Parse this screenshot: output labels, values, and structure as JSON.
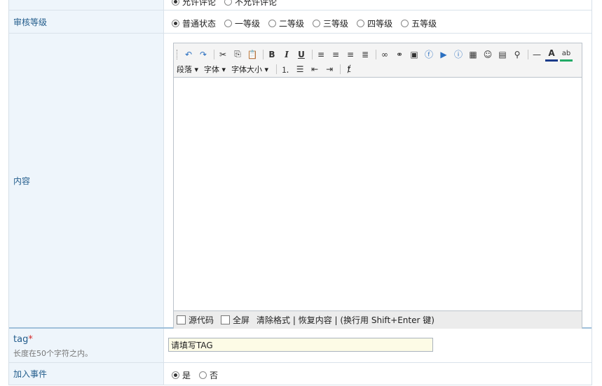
{
  "rows": {
    "comment": {
      "options": [
        {
          "label": "允许评论",
          "checked": true
        },
        {
          "label": "不允许评论",
          "checked": false
        }
      ]
    },
    "review": {
      "label": "审核等级",
      "options": [
        {
          "label": "普通状态",
          "checked": true
        },
        {
          "label": "一等级",
          "checked": false
        },
        {
          "label": "二等级",
          "checked": false
        },
        {
          "label": "三等级",
          "checked": false
        },
        {
          "label": "四等级",
          "checked": false
        },
        {
          "label": "五等级",
          "checked": false
        }
      ]
    },
    "content": {
      "label": "内容"
    },
    "tag": {
      "label": "tag",
      "required_mark": "*",
      "hint": "长度在50个字符之内。",
      "value": "请填写TAG"
    },
    "event": {
      "label": "加入事件",
      "options": [
        {
          "label": "是",
          "checked": true
        },
        {
          "label": "否",
          "checked": false
        }
      ]
    }
  },
  "editor": {
    "toolbar_row1": [
      {
        "name": "undo-icon",
        "glyph": "↶"
      },
      {
        "name": "redo-icon",
        "glyph": "↷"
      },
      {
        "sep": true
      },
      {
        "name": "cut-icon",
        "glyph": "✂"
      },
      {
        "name": "copy-icon",
        "glyph": "⎘"
      },
      {
        "name": "paste-icon",
        "glyph": "📋"
      },
      {
        "sep": true
      },
      {
        "name": "bold-icon",
        "glyph": "B"
      },
      {
        "name": "italic-icon",
        "glyph": "I"
      },
      {
        "name": "underline-icon",
        "glyph": "U"
      },
      {
        "sep": true
      },
      {
        "name": "align-left-icon",
        "glyph": "≡"
      },
      {
        "name": "align-center-icon",
        "glyph": "≡"
      },
      {
        "name": "align-right-icon",
        "glyph": "≡"
      },
      {
        "name": "align-justify-icon",
        "glyph": "≣"
      },
      {
        "sep": true
      },
      {
        "name": "link-icon",
        "glyph": "∞"
      },
      {
        "name": "unlink-icon",
        "glyph": "⚭"
      },
      {
        "name": "image-icon",
        "glyph": "▣"
      },
      {
        "name": "flash-icon",
        "glyph": "ⓕ"
      },
      {
        "name": "media-icon",
        "glyph": "▶"
      },
      {
        "name": "info-icon",
        "glyph": "ⓘ"
      },
      {
        "name": "table-icon",
        "glyph": "▦"
      },
      {
        "name": "emoticon-icon",
        "glyph": "☺"
      },
      {
        "name": "page-icon",
        "glyph": "▤"
      },
      {
        "name": "find-icon",
        "glyph": "⚲"
      },
      {
        "sep": true
      },
      {
        "name": "horizontal-rule-icon",
        "glyph": "—"
      },
      {
        "name": "font-color-icon",
        "glyph": "A"
      },
      {
        "name": "highlight-icon",
        "glyph": "ab"
      }
    ],
    "dropdowns": [
      "段落",
      "字体",
      "字体大小"
    ],
    "toolbar_row2": [
      {
        "name": "ordered-list-icon",
        "glyph": "⒈"
      },
      {
        "name": "unordered-list-icon",
        "glyph": "☰"
      },
      {
        "name": "outdent-icon",
        "glyph": "⇤"
      },
      {
        "name": "indent-icon",
        "glyph": "⇥"
      },
      {
        "sep": true
      },
      {
        "name": "clear-format-icon",
        "glyph": "ⱦ"
      }
    ],
    "status": {
      "source_label": "源代码",
      "fullscreen_label": "全屏",
      "actions_text": "清除格式 | 恢复内容 | (换行用 Shift+Enter 键)"
    }
  }
}
